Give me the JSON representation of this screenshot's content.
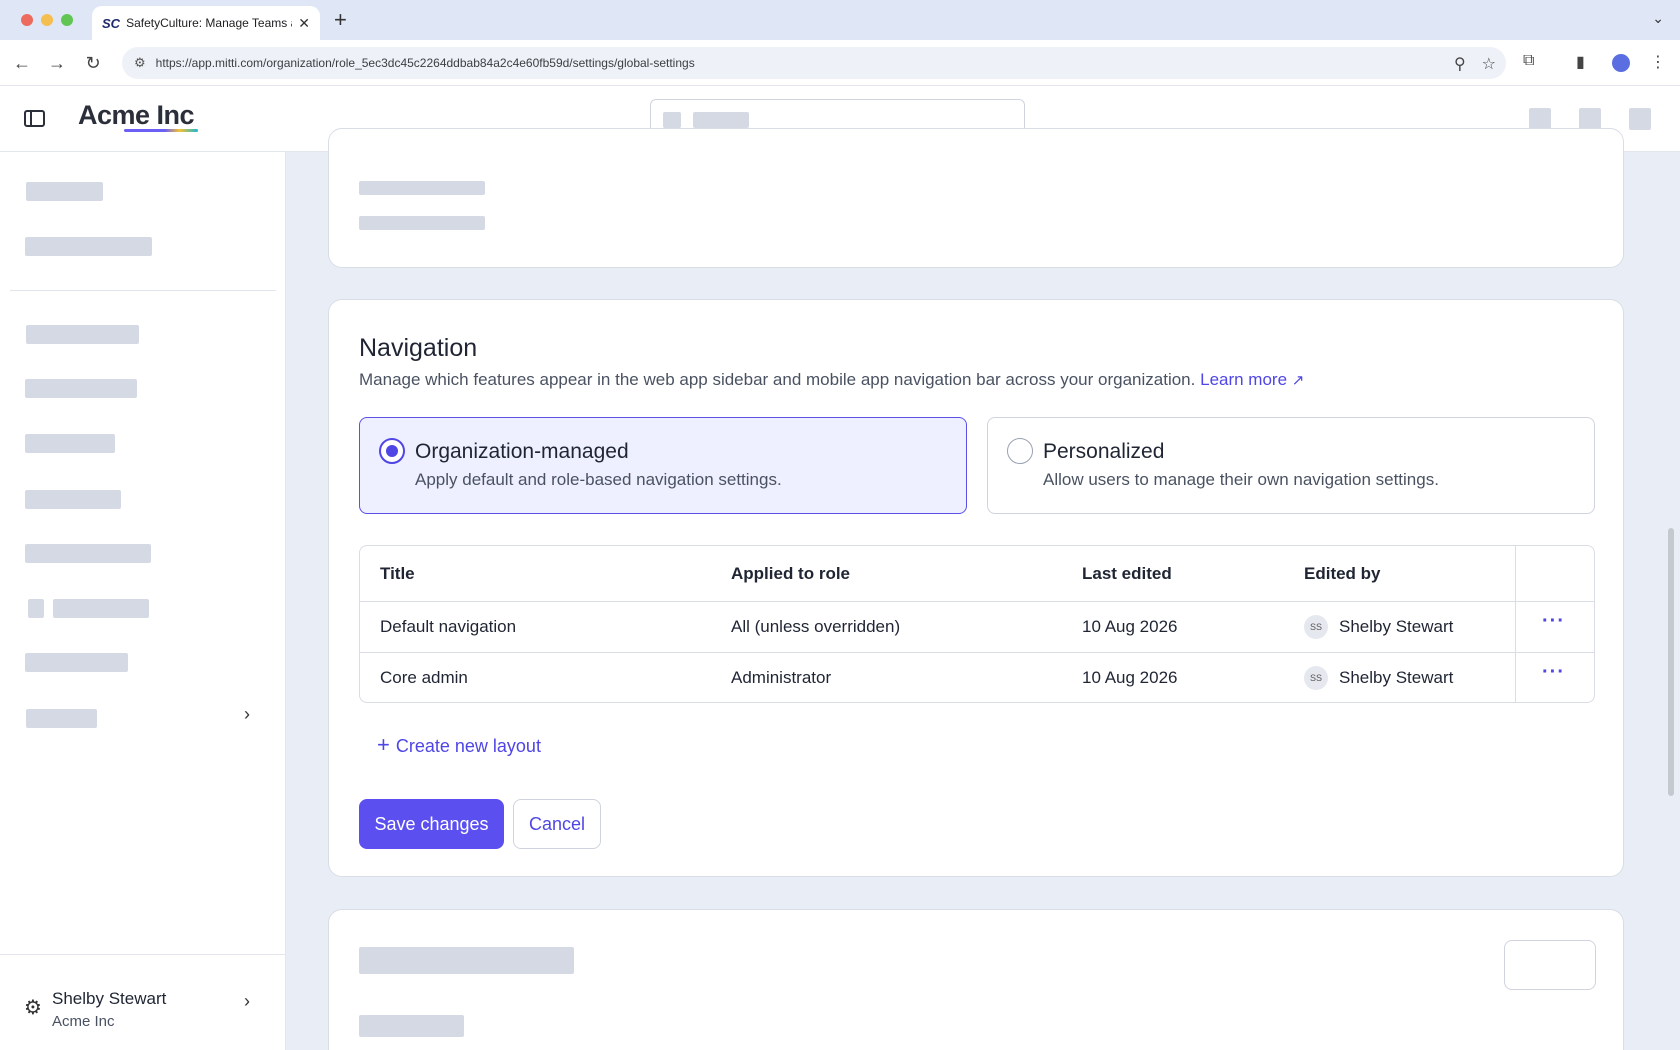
{
  "browser": {
    "tab_favicon": "SC",
    "tab_title": "SafetyCulture: Manage Teams and...",
    "new_tab": "+",
    "url": "https://app.mitti.com/organization/role_5ec3dc45c2264ddbab84a2c4e60fb59d/settings/global-settings"
  },
  "app": {
    "logo": "Acme Inc"
  },
  "sidebar": {
    "user_name": "Shelby Stewart",
    "user_org": "Acme Inc"
  },
  "navigation": {
    "title": "Navigation",
    "description": "Manage which features appear in the web app sidebar and mobile app navigation bar across your organization.",
    "learn_more": "Learn more",
    "options": [
      {
        "title": "Organization-managed",
        "subtitle": "Apply default and role-based navigation settings.",
        "selected": true
      },
      {
        "title": "Personalized",
        "subtitle": "Allow users to manage their own navigation settings.",
        "selected": false
      }
    ],
    "table": {
      "headers": [
        "Title",
        "Applied to role",
        "Last edited",
        "Edited by"
      ],
      "rows": [
        {
          "title": "Default navigation",
          "role": "All (unless overridden)",
          "last_edited": "10 Aug 2026",
          "initials": "SS",
          "edited_by": "Shelby Stewart"
        },
        {
          "title": "Core admin",
          "role": "Administrator",
          "last_edited": "10 Aug 2026",
          "initials": "SS",
          "edited_by": "Shelby Stewart"
        }
      ]
    },
    "create_layout": "Create new layout",
    "save_label": "Save changes",
    "cancel_label": "Cancel"
  },
  "colors": {
    "accent": "#4f46e5",
    "primary_button": "#5b4ff0",
    "selected_option_bg": "#eeefff"
  }
}
